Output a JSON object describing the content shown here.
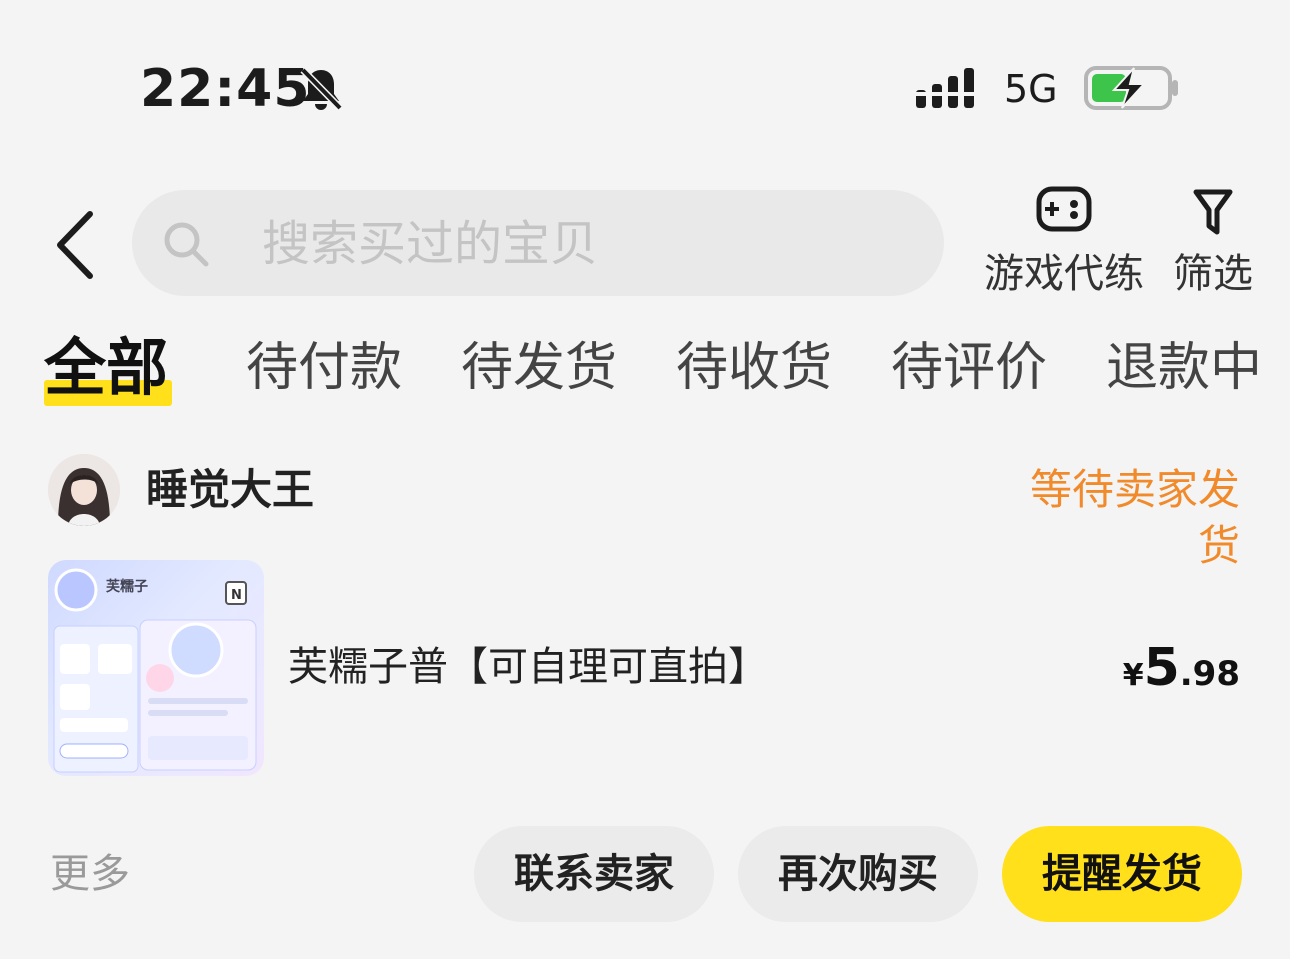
{
  "status_bar": {
    "time": "22:45",
    "network": "5G",
    "icons": [
      "bell-mute-icon",
      "signal-icon",
      "battery-charging-icon"
    ],
    "battery_color": "#3cc44b"
  },
  "header": {
    "search_placeholder": "搜索买过的宝贝",
    "game_label": "游戏代练",
    "filter_label": "筛选"
  },
  "tabs": [
    {
      "label": "全部",
      "active": true
    },
    {
      "label": "待付款"
    },
    {
      "label": "待发货"
    },
    {
      "label": "待收货"
    },
    {
      "label": "待评价"
    },
    {
      "label": "退款中"
    }
  ],
  "order": {
    "seller": "睡觉大王",
    "status": "等待卖家发货",
    "product_title": "芙糯子普【可自理可直拍】",
    "thumb_text": "芙糯子",
    "price": {
      "currency": "¥",
      "integer": "5",
      "decimal": ".98"
    },
    "more": "更多",
    "actions": [
      "联系卖家",
      "再次购买",
      "提醒发货"
    ]
  },
  "colors": {
    "accent": "#ffe01a",
    "status_orange": "#f18a2a",
    "background": "#f4f4f4"
  }
}
